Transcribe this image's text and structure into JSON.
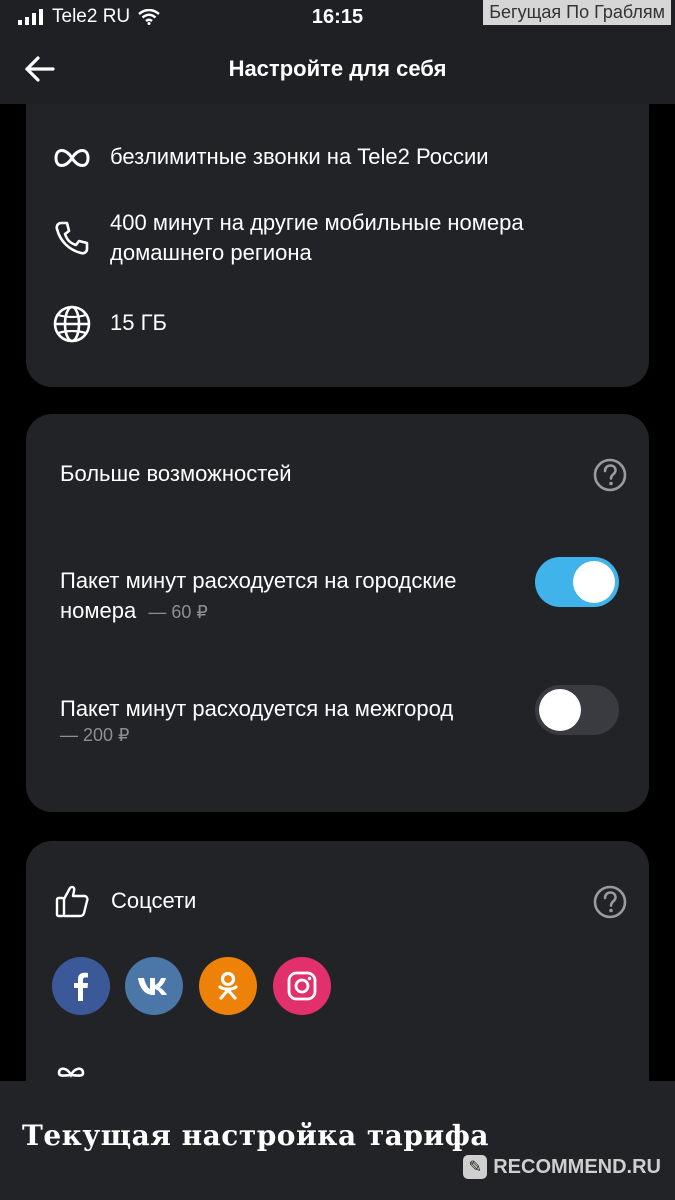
{
  "status_bar": {
    "carrier": "Tele2 RU",
    "time": "16:15"
  },
  "watermark_top": "Бегущая По Граблям",
  "header": {
    "title": "Настройте для себя"
  },
  "features": [
    {
      "icon": "infinity-icon",
      "text": "безлимитные звонки на Tele2 России"
    },
    {
      "icon": "phone-icon",
      "text": "400 минут на другие мобильные номера домашнего региона"
    },
    {
      "icon": "globe-icon",
      "text": "15 ГБ"
    }
  ],
  "more_options": {
    "title": "Больше возможностей",
    "options": [
      {
        "label": "Пакет минут расходуется на городские номера",
        "price": "— 60 ₽",
        "enabled": true
      },
      {
        "label": "Пакет минут расходуется на межгород",
        "price": "— 200 ₽",
        "enabled": false
      }
    ]
  },
  "social": {
    "title": "Соцсети",
    "networks": [
      {
        "name": "facebook",
        "glyph": "f",
        "color": "#3b5998"
      },
      {
        "name": "vk",
        "glyph": "vk",
        "color": "#4a76a8"
      },
      {
        "name": "odnoklassniki",
        "glyph": "ok",
        "color": "#ee8208"
      },
      {
        "name": "instagram",
        "glyph": "ig",
        "color": "#e1306c"
      }
    ]
  },
  "bottom": {
    "title": "Текущая настройка тарифа"
  },
  "watermark_bottom": "RECOMMEND.RU",
  "colors": {
    "accent": "#3fb3ea",
    "card": "#222327",
    "muted": "#8d8e93"
  }
}
